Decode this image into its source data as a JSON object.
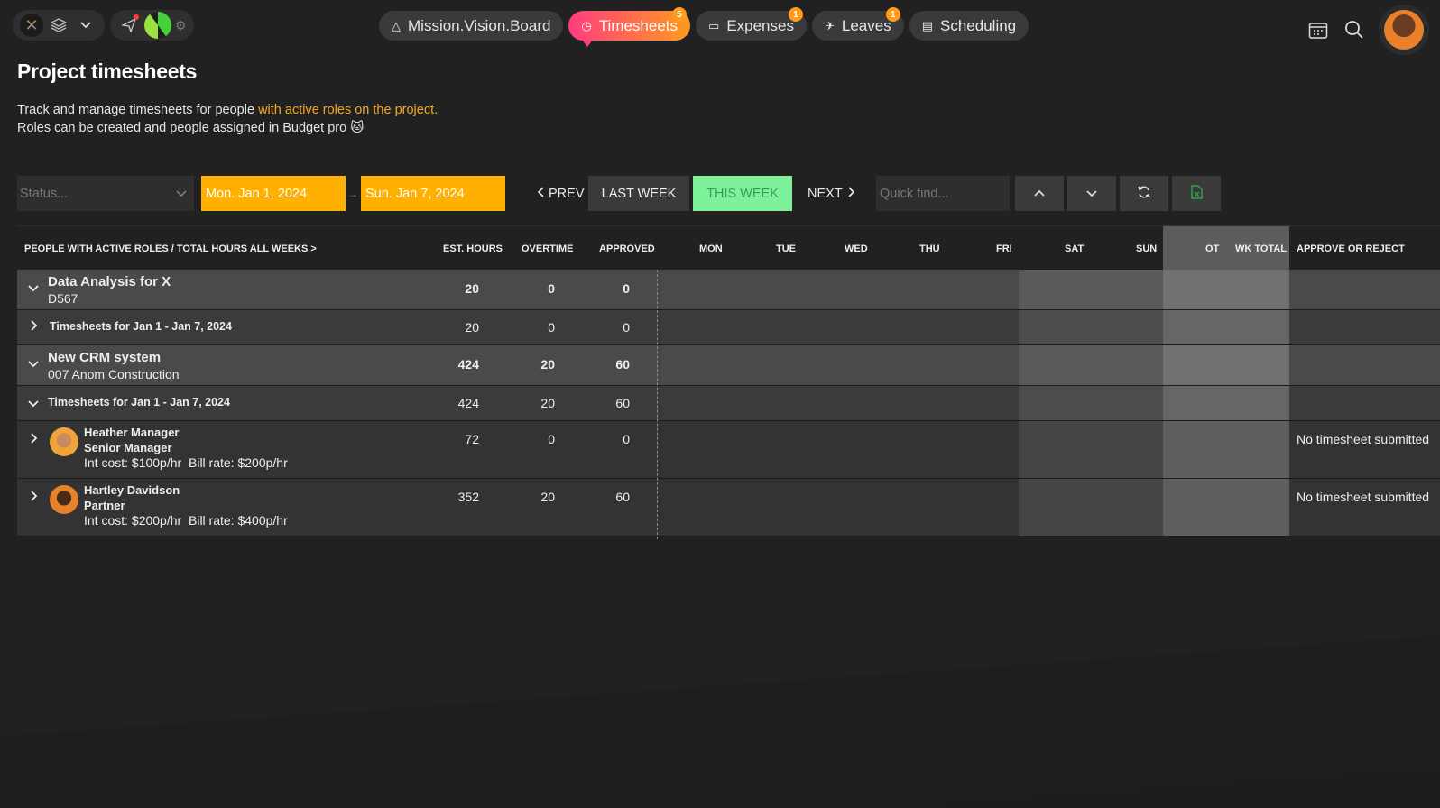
{
  "nav": {
    "tabs": [
      {
        "label": "Mission.Vision.Board",
        "icon": "warning-triangle-icon",
        "badge": ""
      },
      {
        "label": "Timesheets",
        "icon": "clock-icon",
        "badge": "5"
      },
      {
        "label": "Expenses",
        "icon": "card-icon",
        "badge": "1"
      },
      {
        "label": "Leaves",
        "icon": "plane-icon",
        "badge": "1"
      },
      {
        "label": "Scheduling",
        "icon": "calendar-icon",
        "badge": ""
      }
    ]
  },
  "page": {
    "title": "Project timesheets",
    "desc_line1_prefix": "Track and manage timesheets for people ",
    "desc_line1_link": "with active roles on the project.",
    "desc_line2": "Roles can be created and people assigned in Budget pro 🐱"
  },
  "toolbar": {
    "status_placeholder": "Status...",
    "start_date": "Mon. Jan 1, 2024",
    "end_date": "Sun. Jan 7, 2024",
    "prev": "PREV",
    "last_week": "LAST WEEK",
    "this_week": "THIS WEEK",
    "next": "NEXT",
    "quick_find_placeholder": "Quick find..."
  },
  "table": {
    "headers": {
      "people": "PEOPLE WITH ACTIVE ROLES / TOTAL HOURS ALL WEEKS >",
      "est": "EST. HOURS",
      "ot_col": "OVERTIME",
      "approved": "APPROVED",
      "mon": "MON",
      "tue": "TUE",
      "wed": "WED",
      "thu": "THU",
      "fri": "FRI",
      "sat": "SAT",
      "sun": "SUN",
      "ot": "OT",
      "wk_total": "WK TOTAL",
      "approve": "APPROVE OR REJECT"
    },
    "rows": [
      {
        "name": "Data Analysis for X",
        "code": "D567",
        "est": "20",
        "overtime": "0",
        "approved": "0"
      },
      {
        "label": "Timesheets for Jan 1 - Jan 7, 2024",
        "est": "20",
        "overtime": "0",
        "approved": "0"
      },
      {
        "name": "New CRM system",
        "code": "007 Anom Construction",
        "est": "424",
        "overtime": "20",
        "approved": "60"
      },
      {
        "label": "Timesheets for Jan 1 - Jan 7, 2024",
        "est": "424",
        "overtime": "20",
        "approved": "60"
      },
      {
        "name": "Heather Manager",
        "role": "Senior Manager",
        "int_cost": "Int cost: $100p/hr",
        "bill_rate": "Bill rate: $200p/hr",
        "est": "72",
        "overtime": "0",
        "approved": "0",
        "status": "No timesheet submitted"
      },
      {
        "name": "Hartley Davidson",
        "role": "Partner",
        "int_cost": "Int cost: $200p/hr",
        "bill_rate": "Bill rate: $400p/hr",
        "est": "352",
        "overtime": "20",
        "approved": "60",
        "status": "No timesheet submitted"
      }
    ]
  }
}
